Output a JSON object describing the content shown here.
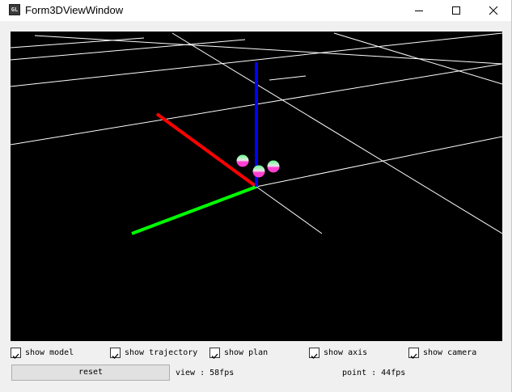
{
  "window": {
    "title": "Form3DViewWindow",
    "app_icon_text": "GL"
  },
  "viewport": {
    "background": "#000000",
    "grid_color": "#ffffff",
    "axis_colors": {
      "x": "#ff0000",
      "y": "#00ff00",
      "z": "#0000ff"
    },
    "marker_colors": [
      "#ff3fd0",
      "#63ff8a"
    ]
  },
  "controls": {
    "checkboxes": [
      {
        "label": "show model",
        "checked": true
      },
      {
        "label": "show trajectory",
        "checked": true
      },
      {
        "label": "show plan",
        "checked": true
      },
      {
        "label": "show axis",
        "checked": true
      },
      {
        "label": "show camera",
        "checked": true
      }
    ],
    "reset_label": "reset",
    "view_fps": "view : 58fps",
    "point_fps": "point : 44fps"
  }
}
